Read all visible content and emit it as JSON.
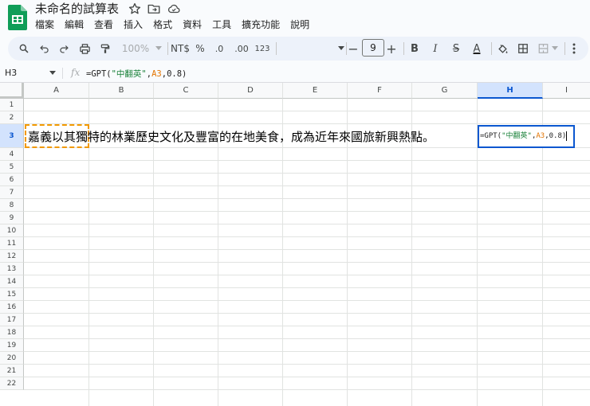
{
  "app": {
    "doc_title": "未命名的試算表",
    "icons": [
      "sheets-logo",
      "star-icon",
      "move-folder-icon",
      "cloud-status-icon"
    ]
  },
  "menu": [
    "檔案",
    "編輯",
    "查看",
    "插入",
    "格式",
    "資料",
    "工具",
    "擴充功能",
    "說明"
  ],
  "toolbar": {
    "zoom": "100%",
    "currency": "NT$",
    "percent": "%",
    "decrease_decimal": ".0",
    "increase_decimal": ".00",
    "number_format": "123",
    "font_size": "9",
    "minus": "−",
    "plus": "+",
    "bold": "B",
    "italic": "I",
    "strikethrough": "S",
    "text_color_label": "A"
  },
  "formula_bar": {
    "name_box": "H3",
    "fx": "fx",
    "formula_parts": [
      "=GPT(",
      "\"中翻英\"",
      ",",
      "A3",
      ",",
      "0.8",
      ")"
    ]
  },
  "grid": {
    "columns": [
      "A",
      "B",
      "C",
      "D",
      "E",
      "F",
      "G",
      "H",
      "I"
    ],
    "selected_column": "H",
    "rows": [
      "1",
      "2",
      "3",
      "4",
      "5",
      "6",
      "7",
      "8",
      "9",
      "10",
      "11",
      "12",
      "13",
      "14",
      "15",
      "16",
      "17",
      "18",
      "19",
      "20",
      "21",
      "22"
    ],
    "selected_row": "3"
  },
  "cells": {
    "A3": "嘉義以其獨特的林業歷史文化及豐富的在地美食，成為近年來國旅新興熱點。",
    "H3_parts": [
      "=GPT(",
      "\"中翻英\"",
      ",",
      "A3",
      ",",
      "0.8",
      ")"
    ]
  },
  "colors": {
    "accent_blue": "#0b57d0",
    "selection_fill": "#d3e3fd",
    "copy_border": "#f29900",
    "string_green": "#188038",
    "ref_orange": "#e37400"
  }
}
